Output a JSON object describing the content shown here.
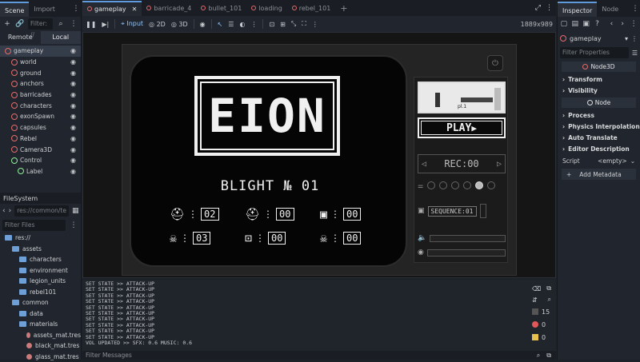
{
  "left_dock": {
    "tabs": [
      "Scene",
      "Import"
    ],
    "filter_placeholder": "Filter: //",
    "remote_label": "Remote",
    "local_label": "Local",
    "scene_tree": [
      {
        "label": "gameplay",
        "color": "#e56b6b"
      },
      {
        "label": "world",
        "color": "#e56b6b"
      },
      {
        "label": "ground",
        "color": "#e56b6b"
      },
      {
        "label": "anchors",
        "color": "#e56b6b"
      },
      {
        "label": "barricades",
        "color": "#e56b6b"
      },
      {
        "label": "characters",
        "color": "#e56b6b"
      },
      {
        "label": "exonSpawn",
        "color": "#e56b6b"
      },
      {
        "label": "capsules",
        "color": "#e56b6b"
      },
      {
        "label": "Rebel",
        "color": "#e56b6b"
      },
      {
        "label": "Camera3D",
        "color": "#e56b6b"
      },
      {
        "label": "Control",
        "color": "#8eef97"
      },
      {
        "label": "Label",
        "color": "#8eef97"
      }
    ],
    "filesystem_title": "FileSystem",
    "path": "res://common/te",
    "filter_files": "Filter Files",
    "files": [
      {
        "label": "res://",
        "indent": 0
      },
      {
        "label": "assets",
        "indent": 1
      },
      {
        "label": "characters",
        "indent": 2
      },
      {
        "label": "environment",
        "indent": 2
      },
      {
        "label": "legion_units",
        "indent": 2
      },
      {
        "label": "rebel101",
        "indent": 2
      },
      {
        "label": "common",
        "indent": 1
      },
      {
        "label": "data",
        "indent": 2
      },
      {
        "label": "materials",
        "indent": 2
      },
      {
        "label": "assets_mat.tres",
        "indent": 3
      },
      {
        "label": "black_mat.tres",
        "indent": 3
      },
      {
        "label": "glass_mat.tres",
        "indent": 3
      }
    ]
  },
  "main": {
    "scene_tabs": [
      "gameplay",
      "barricade_4",
      "bullet_101",
      "loading",
      "rebel_101"
    ],
    "modes": {
      "input": "Input",
      "two_d": "2D",
      "three_d": "3D"
    },
    "resolution": "1889x989",
    "game": {
      "logo": "EION",
      "title": "BLIGHT № 01",
      "counters": [
        {
          "value": "02",
          "icon": "helmet-icon"
        },
        {
          "value": "00",
          "icon": "helmet-icon"
        },
        {
          "value": "00",
          "icon": "mech-icon"
        },
        {
          "value": "03",
          "icon": "skull-icon"
        },
        {
          "value": "00",
          "icon": "robot-icon"
        },
        {
          "value": "00",
          "icon": "skull-icon"
        }
      ],
      "play": "PLAY",
      "rec": "REC:00",
      "sequence": "SEQUENCE:01",
      "preview_label": "pl.1"
    },
    "console_lines": [
      "SET STATE >> ATTACK-UP",
      "SET STATE >> ATTACK-UP",
      "SET STATE >> ATTACK-UP",
      "SET STATE >> ATTACK-UP",
      "SET STATE >> ATTACK-UP",
      "SET STATE >> ATTACK-UP",
      "SET STATE >> ATTACK-UP",
      "SET STATE >> ATTACK-UP",
      "SET STATE >> ATTACK-UP",
      "SET STATE >> ATTACK-UP",
      "VOL UPDATED >> SFX: 0.6  MUSIC: 0.6"
    ],
    "filter_messages": "Filter Messages",
    "console_counts": {
      "messages": "15",
      "errors": "0",
      "warnings": "0"
    }
  },
  "inspector": {
    "tabs": [
      "Inspector",
      "Node"
    ],
    "node_name": "gameplay",
    "filter_placeholder": "Filter Properties",
    "node3d_header": "Node3D",
    "node3d_sections": [
      "Transform",
      "Visibility"
    ],
    "node_header": "Node",
    "node_sections": [
      "Process",
      "Physics Interpolation",
      "Auto Translate",
      "Editor Description"
    ],
    "script_label": "Script",
    "script_value": "<empty>",
    "add_metadata": "Add Metadata"
  }
}
